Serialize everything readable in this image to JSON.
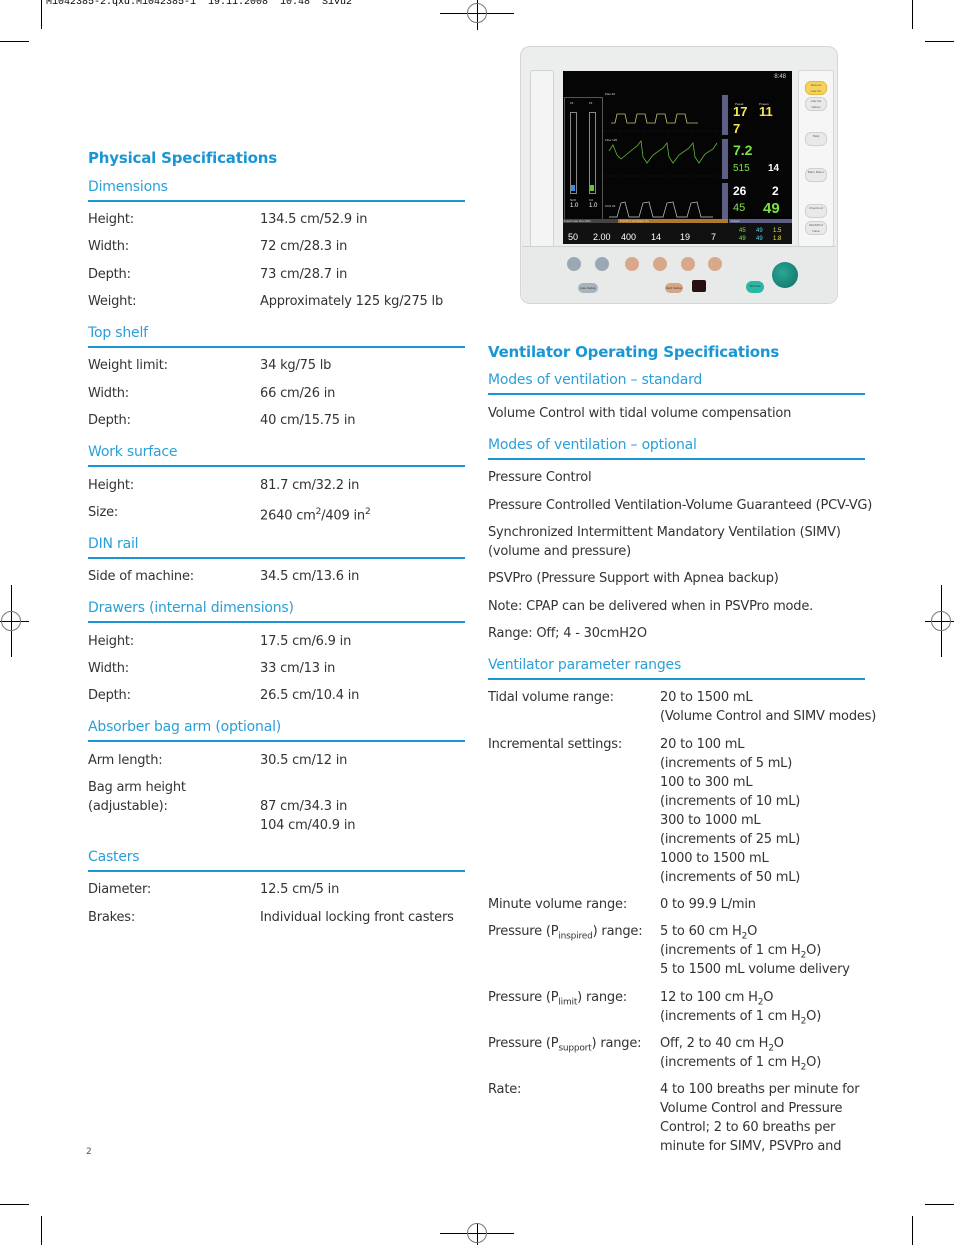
{
  "slug": "M1042385-2.qxd:M1042385-1  19.11.2008  10:48  Sivu2",
  "page_number": "2",
  "colors": {
    "accent": "#1a96d4",
    "text": "#333333"
  },
  "physical": {
    "title": "Physical Specifications",
    "dimensions": {
      "heading": "Dimensions",
      "rows": [
        {
          "label": "Height:",
          "value": "134.5 cm/52.9 in"
        },
        {
          "label": "Width:",
          "value": "72 cm/28.3 in"
        },
        {
          "label": "Depth:",
          "value": "73 cm/28.7 in"
        },
        {
          "label": "Weight:",
          "value": "Approximately 125 kg/275 lb"
        }
      ]
    },
    "top_shelf": {
      "heading": "Top shelf",
      "rows": [
        {
          "label": "Weight limit:",
          "value": "34 kg/75 lb"
        },
        {
          "label": "Width:",
          "value": "66 cm/26 in"
        },
        {
          "label": "Depth:",
          "value": "40 cm/15.75 in"
        }
      ]
    },
    "work_surface": {
      "heading": "Work surface",
      "rows": [
        {
          "label": "Height:",
          "value": "81.7 cm/32.2 in"
        },
        {
          "label": "Size:",
          "value_a": "2640 cm",
          "sup_a": "2",
          "value_b": "/409 in",
          "sup_b": "2"
        }
      ]
    },
    "din_rail": {
      "heading": "DIN rail",
      "rows": [
        {
          "label": "Side of machine:",
          "value": "34.5 cm/13.6 in"
        }
      ]
    },
    "drawers": {
      "heading": "Drawers (internal dimensions)",
      "rows": [
        {
          "label": "Height:",
          "value": "17.5 cm/6.9 in"
        },
        {
          "label": "Width:",
          "value": "33 cm/13 in"
        },
        {
          "label": "Depth:",
          "value": "26.5 cm/10.4 in"
        }
      ]
    },
    "absorber": {
      "heading": "Absorber bag arm (optional)",
      "rows": [
        {
          "label": "Arm length:",
          "value": "30.5 cm/12 in"
        },
        {
          "label_line1": "Bag arm height",
          "label_line2": "(adjustable):",
          "value_line1": "87 cm/34.3 in",
          "value_line2": "104 cm/40.9 in"
        }
      ]
    },
    "casters": {
      "heading": "Casters",
      "rows": [
        {
          "label": "Diameter:",
          "value": "12.5 cm/5 in"
        },
        {
          "label": "Brakes:",
          "value": "Individual locking front casters"
        }
      ]
    }
  },
  "device_image": {
    "alt": "Ventilator monitor display",
    "clock": "8:48",
    "screen": {
      "left_bars": [
        {
          "top": "15",
          "unit": "l/min",
          "name": "N2O",
          "value": "1.0",
          "color": "#3a8fe0"
        },
        {
          "top": "15",
          "unit": "l/min",
          "name": "O2",
          "value": "1.0",
          "color": "#6cc04a"
        }
      ],
      "waveforms": [
        {
          "label": "Paw  40",
          "color": "#c8c070"
        },
        {
          "label": "Flow  120",
          "color": "#5fb83a"
        },
        {
          "label": "CO2  20",
          "color": "#cccccc"
        }
      ],
      "side_tabs": [
        "P A W",
        "F L O W",
        "C O 2 / O 2"
      ],
      "paw": {
        "unit": "cmH2O",
        "ppeak_label": "Ppeak",
        "ppeak": "17",
        "pmean_label": "Pmean",
        "pmean": "11",
        "peep_label": "PEEP",
        "peep": "7"
      },
      "flow": {
        "mv_label": "MV  l/min",
        "mv": "7.2",
        "tvexp_label": "TVexp  ml",
        "tvexp": "515",
        "rr_label": "RR  /min",
        "rr": "14"
      },
      "gas": {
        "etco2_label": "EtCO2  mmHg",
        "etco2": "26",
        "fico2_label": "FiCO2  mmHg",
        "fico2": "2",
        "eto2_label": "EtO2  %",
        "eto2": "45",
        "fio2_label": "FiO2  %",
        "fio2": "49"
      },
      "fresh_gas": {
        "header": "Fresh Gas  O2+N2O",
        "o2_label": "O2 %",
        "o2": "50",
        "total_label": "Total Flow l/min",
        "total": "2.00"
      },
      "vent_settings": {
        "header": "PSVPro  Ventilator On",
        "items": [
          {
            "label": "TV ml",
            "value": "400"
          },
          {
            "label": "RR /min",
            "value": "14"
          },
          {
            "label": "P Support cmH2O",
            "value": "19"
          },
          {
            "label": "PEEP cmH2O",
            "value": "7"
          }
        ]
      },
      "agents": {
        "header": "Gases",
        "cols": [
          "O2",
          "N2O",
          "Des"
        ],
        "fi": [
          "45",
          "49",
          "1.5"
        ],
        "et": [
          "49",
          "49",
          "1.8"
        ]
      }
    },
    "side_buttons": [
      "Silence Alarms",
      "Alarms Setup",
      "Help",
      "Main Menu",
      "Checkout",
      "Start/End Case"
    ],
    "bottom_buttons": [
      "Gas Setup",
      "Vent Setup",
      "Normal Screen"
    ]
  },
  "ventilator": {
    "title": "Ventilator Operating Specifications",
    "standard": {
      "heading": "Modes of ventilation – standard",
      "lines": [
        "Volume Control with tidal volume compensation"
      ]
    },
    "optional": {
      "heading": "Modes of ventilation – optional",
      "lines": [
        "Pressure Control",
        "Pressure Controlled Ventilation-Volume Guaranteed (PCV-VG)",
        "Synchronized Intermittent Mandatory Ventilation (SIMV)",
        "(volume and pressure)",
        "PSVPro (Pressure Support with Apnea backup)",
        "Note: CPAP can be delivered when in PSVPro mode.",
        "Range: Off; 4 - 30cmH2O"
      ]
    },
    "ranges": {
      "heading": "Ventilator parameter ranges",
      "tidal": {
        "label": "Tidal volume range:",
        "lines": [
          "20 to 1500 mL",
          "(Volume Control and SIMV modes)"
        ]
      },
      "incremental": {
        "label": "Incremental settings:",
        "lines": [
          "20 to 100 mL",
          "(increments of 5 mL)",
          "100 to 300 mL",
          "(increments of 10 mL)",
          "300 to 1000 mL",
          "(increments of 25 mL)",
          "1000 to 1500 mL",
          "(increments of 50 mL)"
        ]
      },
      "minute": {
        "label": "Minute volume range:",
        "value": "0 to 99.9 L/min"
      },
      "pinsp": {
        "label_pre": "Pressure (P",
        "label_sub": "inspired",
        "label_post": ") range:",
        "l1_pre": "5 to 60 cm H",
        "l1_sub": "2",
        "l1_post": "O",
        "l2_pre": "(increments of 1 cm H",
        "l2_sub": "2",
        "l2_post": "O)",
        "l3": "5 to 1500 mL volume delivery"
      },
      "plimit": {
        "label_pre": "Pressure (P",
        "label_sub": "limit",
        "label_post": ") range:",
        "l1_pre": "12 to 100 cm H",
        "l1_sub": "2",
        "l1_post": "O",
        "l2_pre": "(increments of 1 cm H",
        "l2_sub": "2",
        "l2_post": "O)"
      },
      "psupport": {
        "label_pre": "Pressure (P",
        "label_sub": "support",
        "label_post": ") range:",
        "l1_pre": "Off, 2 to 40 cm H",
        "l1_sub": "2",
        "l1_post": "O",
        "l2_pre": "(increments of 1 cm H",
        "l2_sub": "2",
        "l2_post": "O)"
      },
      "rate": {
        "label": "Rate:",
        "lines": [
          "4 to 100 breaths per minute for",
          "Volume Control and Pressure",
          "Control; 2 to 60 breaths per",
          "minute for SIMV, PSVPro and"
        ]
      }
    }
  }
}
